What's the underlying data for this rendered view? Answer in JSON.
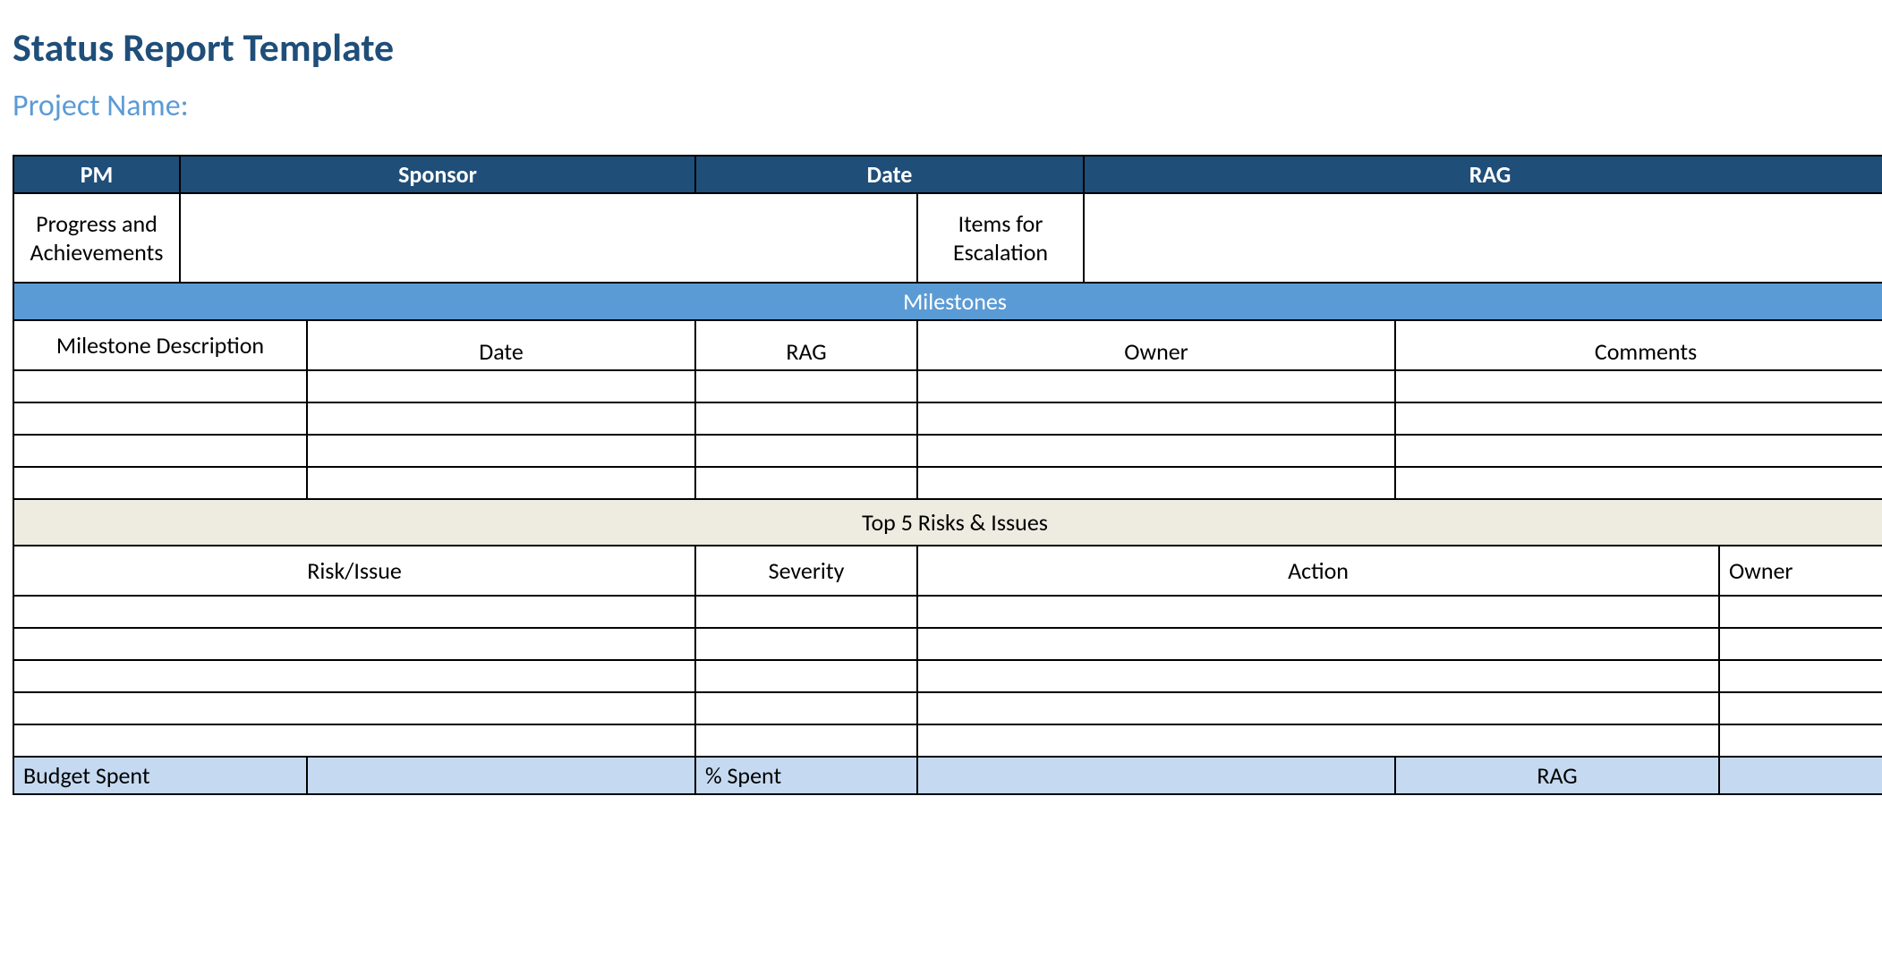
{
  "title": "Status Report Template",
  "subtitle": "Project Name:",
  "header": {
    "pm": "PM",
    "sponsor": "Sponsor",
    "date": "Date",
    "rag": "RAG"
  },
  "labels": {
    "progress": "Progress and Achievements",
    "escalation": "Items for Escalation"
  },
  "milestones": {
    "bar": "Milestones",
    "cols": {
      "desc": "Milestone Description",
      "date": "Date",
      "rag": "RAG",
      "owner": "Owner",
      "comments": "Comments"
    }
  },
  "risks": {
    "bar": "Top 5 Risks & Issues",
    "cols": {
      "issue": "Risk/Issue",
      "severity": "Severity",
      "action": "Action",
      "owner": "Owner"
    }
  },
  "budget": {
    "spent": "Budget Spent",
    "pct": "% Spent",
    "rag": "RAG"
  }
}
